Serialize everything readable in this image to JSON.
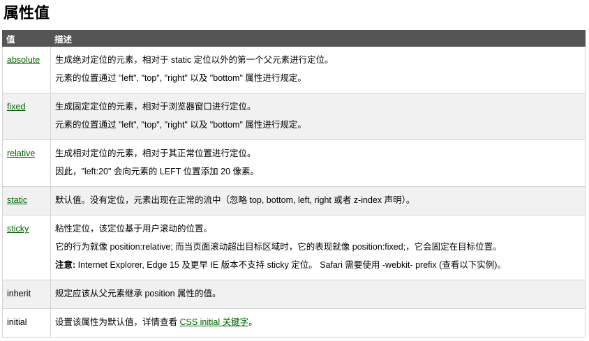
{
  "title": "属性值",
  "headers": {
    "value": "值",
    "description": "描述"
  },
  "rows": [
    {
      "value": "absolute",
      "lines": [
        "生成绝对定位的元素，相对于 static 定位以外的第一个父元素进行定位。",
        "元素的位置通过 \"left\", \"top\", \"right\" 以及 \"bottom\" 属性进行规定。"
      ]
    },
    {
      "value": "fixed",
      "lines": [
        "生成固定定位的元素，相对于浏览器窗口进行定位。",
        "元素的位置通过 \"left\", \"top\", \"right\" 以及 \"bottom\" 属性进行规定。"
      ]
    },
    {
      "value": "relative",
      "lines": [
        "生成相对定位的元素，相对于其正常位置进行定位。",
        "因此，\"left:20\" 会向元素的 LEFT 位置添加 20 像素。"
      ]
    },
    {
      "value": "static",
      "lines": [
        "默认值。没有定位，元素出现在正常的流中（忽略 top, bottom, left, right 或者 z-index 声明）。"
      ]
    },
    {
      "value": "sticky",
      "lines": [
        "粘性定位，该定位基于用户滚动的位置。",
        "它的行为就像 position:relative; 而当页面滚动超出目标区域时，它的表现就像 position:fixed;，它会固定在目标位置。"
      ],
      "note_label": "注意:",
      "note_text": " Internet Explorer, Edge 15 及更早 IE 版本不支持 sticky 定位。 Safari 需要使用 -webkit- prefix (查看以下实例)。"
    },
    {
      "value": "inherit",
      "lines": [
        "规定应该从父元素继承 position 属性的值。"
      ]
    },
    {
      "value": "initial",
      "text_before": "设置该属性为默认值，详情查看 ",
      "link_text": "CSS initial 关键字",
      "text_after": "。"
    }
  ]
}
